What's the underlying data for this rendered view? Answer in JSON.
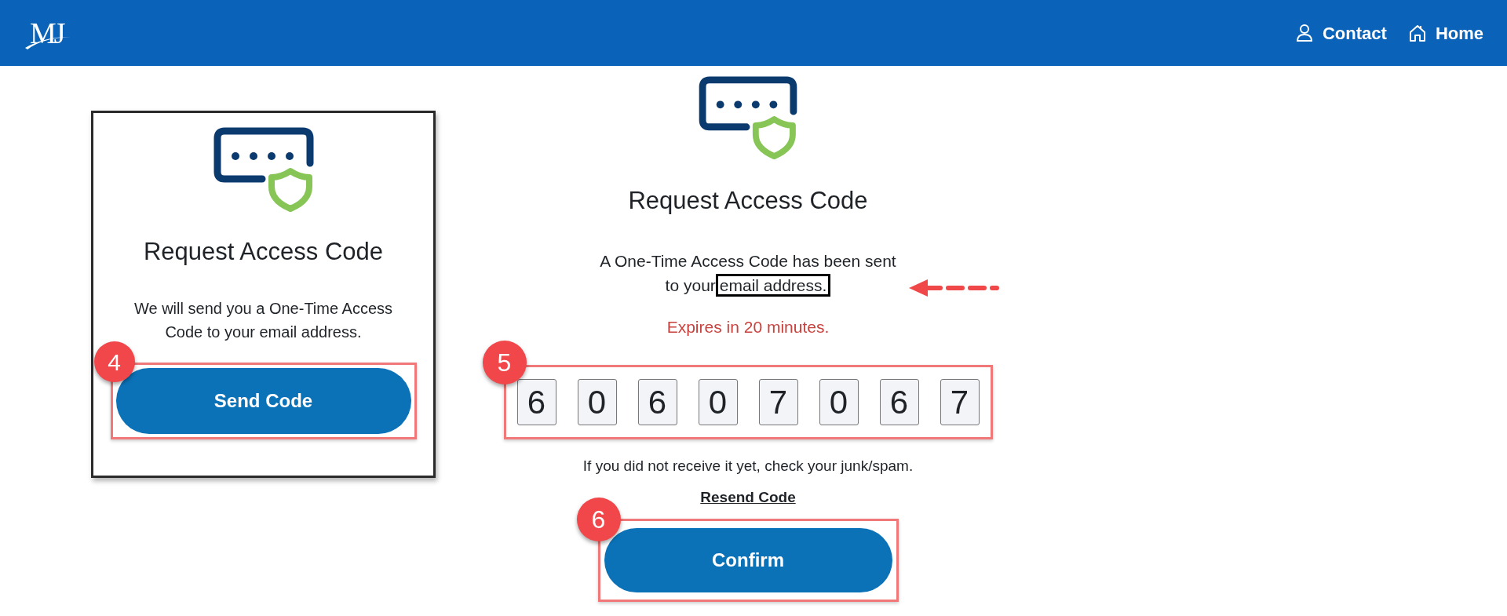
{
  "header": {
    "logo": "MJ",
    "links": [
      {
        "label": "Contact",
        "kind": "person"
      },
      {
        "label": "Home",
        "kind": "home"
      }
    ]
  },
  "request_card": {
    "title": "Request Access Code",
    "description": "We will send you a One-Time Access Code to your email address.",
    "button": "Send Code",
    "step_badge": "4"
  },
  "verify_panel": {
    "title": "Request Access Code",
    "message_lines": [
      "A One-Time Access Code has been sent",
      "to your"
    ],
    "message_highlight": "email address.",
    "expiry": "Expires in 20 minutes.",
    "code_digits": [
      "6",
      "0",
      "6",
      "0",
      "7",
      "0",
      "6",
      "7"
    ],
    "code_badge": "5",
    "hint": "If you did not receive it yet, check your junk/spam.",
    "resend_link": "Resend Code",
    "confirm_button": "Confirm",
    "confirm_badge": "6"
  }
}
